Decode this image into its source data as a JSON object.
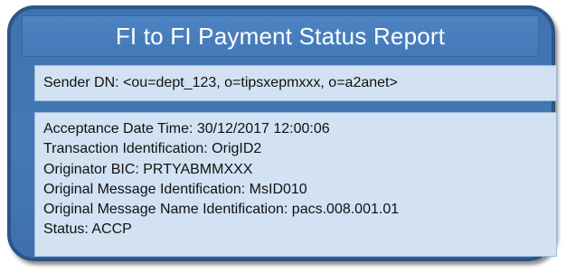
{
  "title": "FI to FI Payment Status Report",
  "sender": "Sender DN: <ou=dept_123, o=tipsxepmxxx, o=a2anet>",
  "details": [
    "Acceptance Date Time: 30/12/2017 12:00:06",
    "Transaction Identification: OrigID2",
    "Originator BIC: PRTYABMMXXX",
    "Original Message Identification: MsID010",
    "Original Message Name Identification: pacs.008.001.01",
    "Status: ACCP"
  ],
  "colors": {
    "outer_fill": "#4478b6",
    "outer_border": "#2c5487",
    "title_fill": "#4a80c0",
    "inner_fill": "#d2e2f3",
    "text": "#111111"
  }
}
